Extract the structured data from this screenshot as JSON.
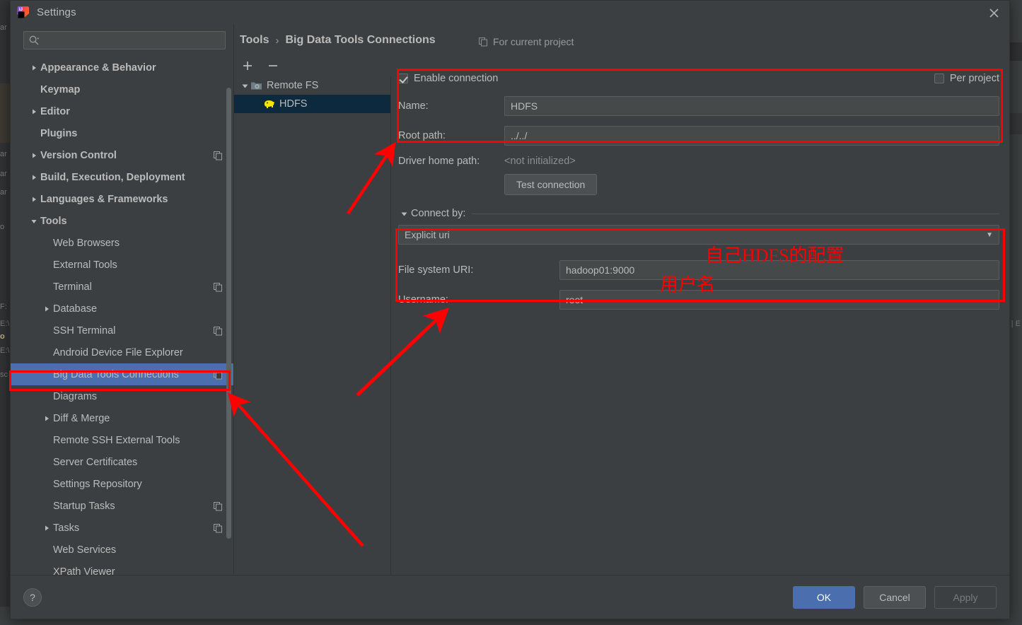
{
  "window": {
    "title": "Settings",
    "close_label": "close-window",
    "logo_name": "intellij-idea-logo"
  },
  "search": {
    "value": "",
    "placeholder": ""
  },
  "sidebar": {
    "items": [
      {
        "label": "Appearance & Behavior",
        "arrow": "right",
        "indent": 0,
        "bold": true,
        "selected": false,
        "copy": false
      },
      {
        "label": "Keymap",
        "arrow": "none",
        "indent": 0,
        "bold": true,
        "selected": false,
        "copy": false
      },
      {
        "label": "Editor",
        "arrow": "right",
        "indent": 0,
        "bold": true,
        "selected": false,
        "copy": false
      },
      {
        "label": "Plugins",
        "arrow": "none",
        "indent": 0,
        "bold": true,
        "selected": false,
        "copy": false
      },
      {
        "label": "Version Control",
        "arrow": "right",
        "indent": 0,
        "bold": true,
        "selected": false,
        "copy": true
      },
      {
        "label": "Build, Execution, Deployment",
        "arrow": "right",
        "indent": 0,
        "bold": true,
        "selected": false,
        "copy": false
      },
      {
        "label": "Languages & Frameworks",
        "arrow": "right",
        "indent": 0,
        "bold": true,
        "selected": false,
        "copy": false
      },
      {
        "label": "Tools",
        "arrow": "down",
        "indent": 0,
        "bold": true,
        "selected": false,
        "copy": false
      },
      {
        "label": "Web Browsers",
        "arrow": "none",
        "indent": 1,
        "bold": false,
        "selected": false,
        "copy": false
      },
      {
        "label": "External Tools",
        "arrow": "none",
        "indent": 1,
        "bold": false,
        "selected": false,
        "copy": false
      },
      {
        "label": "Terminal",
        "arrow": "none",
        "indent": 1,
        "bold": false,
        "selected": false,
        "copy": true
      },
      {
        "label": "Database",
        "arrow": "right",
        "indent": 1,
        "bold": false,
        "selected": false,
        "copy": false
      },
      {
        "label": "SSH Terminal",
        "arrow": "none",
        "indent": 1,
        "bold": false,
        "selected": false,
        "copy": true
      },
      {
        "label": "Android Device File Explorer",
        "arrow": "none",
        "indent": 1,
        "bold": false,
        "selected": false,
        "copy": false
      },
      {
        "label": "Big Data Tools Connections",
        "arrow": "none",
        "indent": 1,
        "bold": false,
        "selected": true,
        "copy": true
      },
      {
        "label": "Diagrams",
        "arrow": "none",
        "indent": 1,
        "bold": false,
        "selected": false,
        "copy": false
      },
      {
        "label": "Diff & Merge",
        "arrow": "right",
        "indent": 1,
        "bold": false,
        "selected": false,
        "copy": false
      },
      {
        "label": "Remote SSH External Tools",
        "arrow": "none",
        "indent": 1,
        "bold": false,
        "selected": false,
        "copy": false
      },
      {
        "label": "Server Certificates",
        "arrow": "none",
        "indent": 1,
        "bold": false,
        "selected": false,
        "copy": false
      },
      {
        "label": "Settings Repository",
        "arrow": "none",
        "indent": 1,
        "bold": false,
        "selected": false,
        "copy": false
      },
      {
        "label": "Startup Tasks",
        "arrow": "none",
        "indent": 1,
        "bold": false,
        "selected": false,
        "copy": true
      },
      {
        "label": "Tasks",
        "arrow": "right",
        "indent": 1,
        "bold": false,
        "selected": false,
        "copy": true
      },
      {
        "label": "Web Services",
        "arrow": "none",
        "indent": 1,
        "bold": false,
        "selected": false,
        "copy": false
      },
      {
        "label": "XPath Viewer",
        "arrow": "none",
        "indent": 1,
        "bold": false,
        "selected": false,
        "copy": false
      }
    ]
  },
  "breadcrumb": {
    "parent": "Tools",
    "separator": "›",
    "current": "Big Data Tools Connections",
    "scope": "For current project"
  },
  "tree": {
    "add_label": "+",
    "remove_label": "−",
    "nodes": [
      {
        "label": "Remote FS",
        "icon": "remote-fs-folder-icon",
        "selected": false,
        "child": false
      },
      {
        "label": "HDFS",
        "icon": "hadoop-elephant-icon",
        "selected": true,
        "child": true
      }
    ]
  },
  "form": {
    "enable_connection_label": "Enable connection",
    "enable_connection_checked": true,
    "per_project_label": "Per project",
    "per_project_checked": false,
    "name_label": "Name:",
    "name_value": "HDFS",
    "root_path_label": "Root path:",
    "root_path_value": "../../",
    "driver_home_label": "Driver home path:",
    "driver_home_value": "<not initialized>",
    "test_connection_label": "Test connection",
    "connect_by_label": "Connect by:",
    "connect_by_value": "Explicit uri",
    "fs_uri_label": "File system URI:",
    "fs_uri_value": "hadoop01:9000",
    "username_label": "Username:",
    "username_value": "root"
  },
  "footer": {
    "help_label": "?",
    "ok_label": "OK",
    "cancel_label": "Cancel",
    "apply_label": "Apply"
  },
  "annotations": {
    "color": "#fe0000",
    "note_hdfs_config": "自己HDFS的配置",
    "note_username": "用户名"
  },
  "background": {
    "left_fragments": [
      "ar",
      "ar",
      "ar",
      "ar",
      "o",
      "F:",
      "E:\\",
      "o",
      "E:\\",
      "sc"
    ],
    "right_fragment": "| E"
  }
}
